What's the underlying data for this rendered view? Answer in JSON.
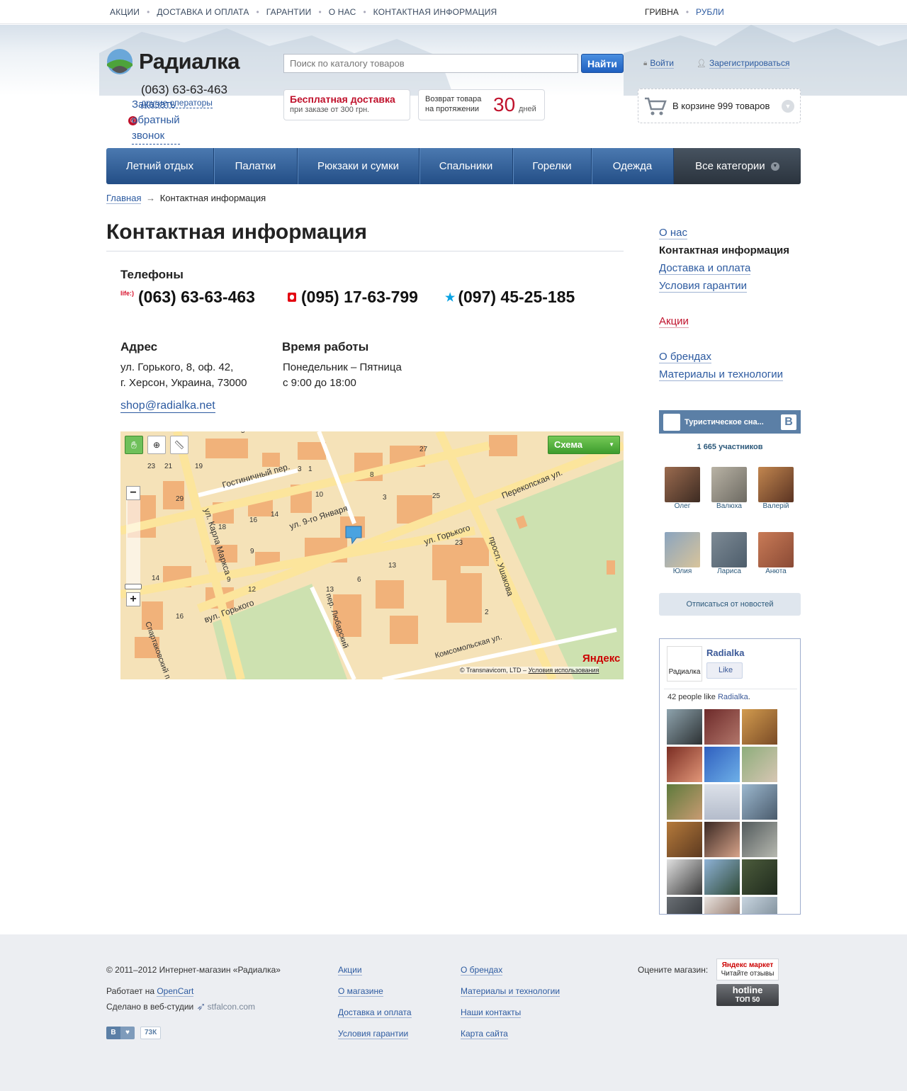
{
  "topnav": {
    "items": [
      "Акции",
      "Доставка и оплата",
      "Гарантии",
      "О нас",
      "Контактная информация"
    ]
  },
  "currency": {
    "items": [
      "Гривна",
      "Рубли"
    ],
    "active": "Гривна"
  },
  "header": {
    "logo_text": "Радиалка",
    "phone": "(063) 63-63-463",
    "other_operators": "другие операторы",
    "callback": "Заказать обратный звонок",
    "search_placeholder": "Поиск по каталогу товаров",
    "search_button": "Найти",
    "login": "Войти",
    "register": "Зарегистрироваться",
    "delivery_title": "Бесплатная доставка",
    "delivery_sub": "при заказе от 300 грн.",
    "return_line1": "Возврат товара",
    "return_line2": "на протяжении",
    "return_days": "30",
    "return_unit": "дней",
    "cart_text": "В корзине 999 товаров"
  },
  "mainnav": {
    "items": [
      "Летний отдых",
      "Палатки",
      "Рюкзаки и сумки",
      "Спальники",
      "Горелки",
      "Одежда"
    ],
    "all": "Все категории"
  },
  "breadcrumb": {
    "home": "Главная",
    "arrow": "→",
    "current": "Контактная информация"
  },
  "page": {
    "title": "Контактная информация",
    "phones_label": "Телефоны",
    "phones": [
      {
        "operator_badge": "life:)",
        "number": "(063) 63-63-463",
        "icon": "life-icon"
      },
      {
        "operator_badge": "",
        "number": "(095) 17-63-799",
        "icon": "mts-icon"
      },
      {
        "operator_badge": "",
        "number": "(097) 45-25-185",
        "icon": "kyivstar-icon"
      }
    ],
    "address_label": "Адрес",
    "address_line1": "ул. Горького, 8, оф. 42,",
    "address_line2": "г. Херсон, Украина, 73000",
    "hours_label": "Время работы",
    "hours_line1": "Понедельник – Пятница",
    "hours_line2": "с 9:00 до 18:00",
    "email": "shop@radialka.net"
  },
  "map": {
    "scheme_button": "Схема",
    "streets": [
      "Гостиничный пер.",
      "ул. 9-го Января",
      "ул. Горького",
      "Перекопская ул.",
      "ул. Карла Маркса",
      "просп. Ушакова",
      "вул. Горького",
      "пер. Любарский",
      "Комсомольская ул.",
      "Спартаковский п"
    ],
    "numbers": [
      "27",
      "21",
      "23",
      "19",
      "3",
      "1",
      "8",
      "25",
      "10",
      "3",
      "29",
      "16",
      "18",
      "14",
      "9",
      "23",
      "13",
      "6",
      "13",
      "2",
      "12",
      "9",
      "14",
      "16",
      "5"
    ],
    "brand": "Яндекс",
    "copyright": "© Transnavicom, LTD – ",
    "terms": "Условия использования"
  },
  "sidebar": {
    "links": [
      "О нас",
      "Контактная информация",
      "Доставка и оплата",
      "Условия гарантии",
      "Акции",
      "О брендах",
      "Материалы и технологии"
    ],
    "current": "Контактная информация",
    "promo": "Акции"
  },
  "vk_widget": {
    "title": "Туристическое сна...",
    "count": "1 665 участников",
    "members": [
      "Олег",
      "Валюха",
      "Валерій",
      "Юлия",
      "Лариса",
      "Анюта"
    ],
    "unsubscribe": "Отписаться от новостей"
  },
  "fb_widget": {
    "name": "Radialka",
    "like": "Like",
    "count_prefix": "42 people like ",
    "count_name": "Radialka",
    "count_suffix": "."
  },
  "footer": {
    "copyright": "© 2011–2012 Интернет-магазин «Радиалка»",
    "works_on": "Работает на ",
    "opencart": "OpenCart",
    "made_in": "Сделано в веб-студии",
    "studio": "stfalcon.com",
    "col1": [
      "Акции",
      "О магазине",
      "Доставка и оплата",
      "Условия гарантии"
    ],
    "col2": [
      "О брендах",
      "Материалы и технологии",
      "Наши контакты",
      "Карта сайта"
    ],
    "rate": "Оцените магазин:",
    "ymarket_brand": "Яндекс маркет",
    "ymarket_sub": "Читайте отзывы",
    "hotline_1": "hotline",
    "hotline_2": "ТОП 50",
    "like_count": "73К"
  }
}
